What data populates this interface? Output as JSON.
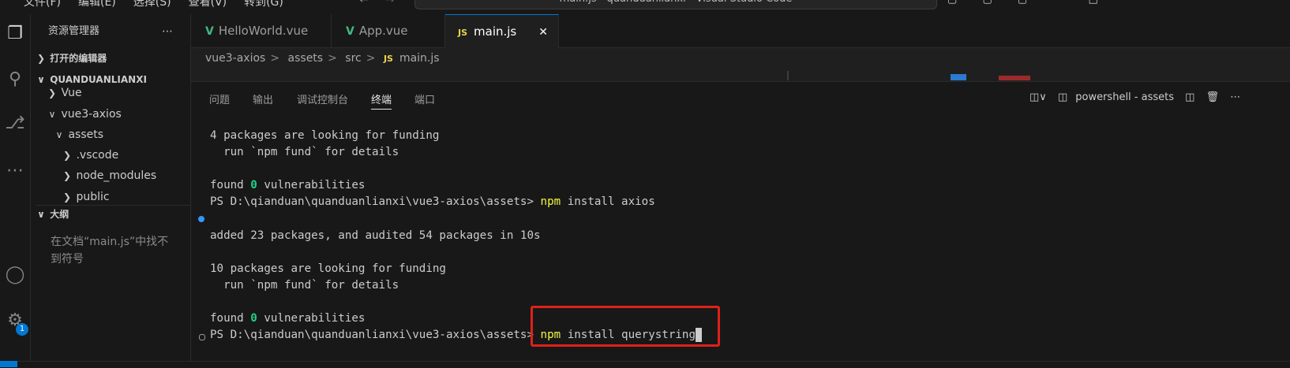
{
  "titlebar": {
    "menu": [
      "文件(F)",
      "编辑(E)",
      "选择(S)",
      "查看(V)",
      "转到(G)"
    ],
    "window_title": "main.js - quanduanlianxi - Visual Studio Code"
  },
  "activity_bar": {
    "icons": [
      "explorer-icon",
      "search-icon",
      "source-control-icon",
      "more-icon",
      "account-icon",
      "settings-icon"
    ],
    "settings_badge": "1"
  },
  "sidebar": {
    "title": "资源管理器",
    "open_editors": "打开的编辑器",
    "workspace": "QUANDUANLIANXI",
    "tree": [
      {
        "label": "Vue",
        "indent": 1,
        "expanded": false
      },
      {
        "label": "vue3-axios",
        "indent": 1,
        "expanded": true
      },
      {
        "label": "assets",
        "indent": 2,
        "expanded": true
      },
      {
        "label": ".vscode",
        "indent": 3,
        "expanded": false
      },
      {
        "label": "node_modules",
        "indent": 3,
        "expanded": false
      },
      {
        "label": "public",
        "indent": 3,
        "expanded": false
      }
    ],
    "outline_title": "大纲",
    "outline_message": "在文档“main.js”中找不到符号"
  },
  "tabs": [
    {
      "label": "HelloWorld.vue",
      "type": "vue",
      "active": false
    },
    {
      "label": "App.vue",
      "type": "vue",
      "active": false
    },
    {
      "label": "main.js",
      "type": "js",
      "active": true
    }
  ],
  "breadcrumb": [
    "vue3-axios",
    "assets",
    "src",
    "main.js"
  ],
  "panel": {
    "tabs": [
      "问题",
      "输出",
      "调试控制台",
      "终端",
      "端口"
    ],
    "active_tab": "终端",
    "terminal_name": "powershell - assets"
  },
  "terminal": {
    "lines": [
      {
        "text": "4 packages are looking for funding"
      },
      {
        "text": "  run `npm fund` for details"
      },
      {
        "text": ""
      },
      {
        "pre": "found ",
        "zero": "0",
        "post": " vulnerabilities"
      },
      {
        "prompt": "PS D:\\qianduan\\quanduanlianxi\\vue3-axios\\assets> ",
        "cmd": "npm",
        "args": " install axios"
      },
      {
        "text": ""
      },
      {
        "text": "added 23 packages, and audited 54 packages in 10s"
      },
      {
        "text": ""
      },
      {
        "text": "10 packages are looking for funding"
      },
      {
        "text": "  run `npm fund` for details"
      },
      {
        "text": ""
      },
      {
        "pre": "found ",
        "zero": "0",
        "post": " vulnerabilities"
      },
      {
        "prompt": "PS D:\\qianduan\\quanduanlianxi\\vue3-axios\\assets> ",
        "cmd": "npm",
        "args": " install querystring",
        "cursor": true
      }
    ]
  },
  "colors": {
    "accent": "#0078d4",
    "highlight_box": "#e0201b",
    "command": "#f5f543",
    "zero": "#23d18b"
  }
}
